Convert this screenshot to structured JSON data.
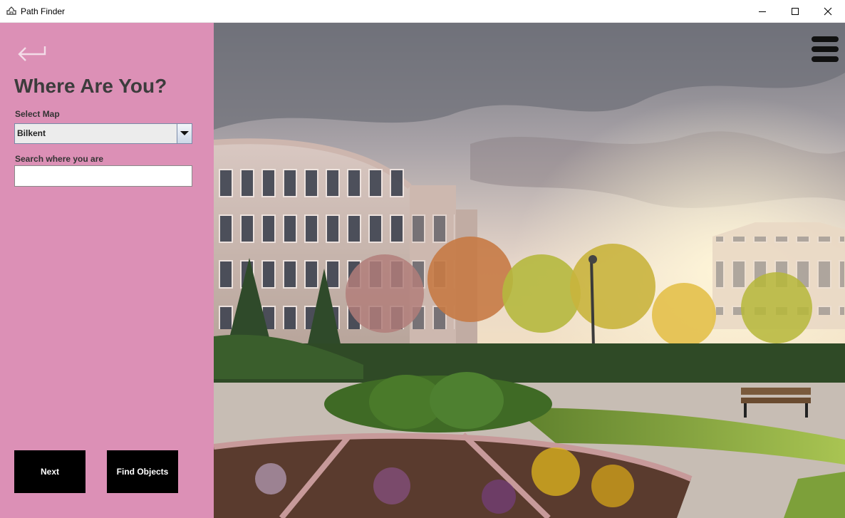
{
  "window": {
    "title": "Path Finder",
    "controls": [
      "minimize-icon",
      "maximize-icon",
      "close-icon"
    ]
  },
  "sidebar": {
    "background": "#dc90b6",
    "back_icon": "return-arrow-icon",
    "heading": "Where Are You?",
    "map_select": {
      "label": "Select Map",
      "value": "Bilkent"
    },
    "search": {
      "label": "Search where you are",
      "value": "",
      "placeholder": ""
    },
    "buttons": {
      "next": "Next",
      "find_objects": "Find Objects"
    }
  },
  "main": {
    "image": "campus-photo",
    "menu_icon": "hamburger-menu-icon"
  }
}
